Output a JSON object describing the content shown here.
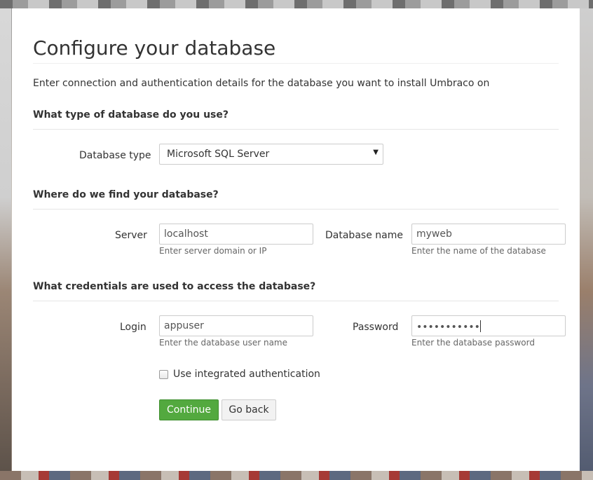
{
  "page": {
    "title": "Configure your database",
    "intro": "Enter connection and authentication details for the database you want to install Umbraco on"
  },
  "sections": {
    "type": {
      "heading": "What type of database do you use?"
    },
    "location": {
      "heading": "Where do we find your database?"
    },
    "credentials": {
      "heading": "What credentials are used to access the database?"
    }
  },
  "database_type": {
    "label": "Database type",
    "selected": "Microsoft SQL Server"
  },
  "server": {
    "label": "Server",
    "value": "localhost",
    "help": "Enter server domain or IP"
  },
  "database_name": {
    "label": "Database name",
    "value": "myweb",
    "help": "Enter the name of the database"
  },
  "login": {
    "label": "Login",
    "value": "appuser",
    "help": "Enter the database user name"
  },
  "password": {
    "label": "Password",
    "masked_value": "•••••••••••",
    "help": "Enter the database password"
  },
  "integrated_auth": {
    "label": "Use integrated authentication",
    "checked": false
  },
  "buttons": {
    "continue": "Continue",
    "go_back": "Go back"
  },
  "icons": {
    "select_caret": "caret-down-icon"
  },
  "colors": {
    "continue_button": "#53a93f",
    "text": "#333333",
    "help_text": "#666666"
  }
}
